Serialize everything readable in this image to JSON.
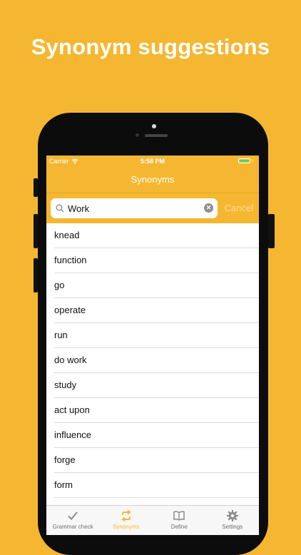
{
  "headline": "Synonym suggestions",
  "status_bar": {
    "carrier": "Carrier",
    "time": "5:58 PM"
  },
  "nav": {
    "title": "Synonyms"
  },
  "search": {
    "value": "Work",
    "cancel_label": "Cancel"
  },
  "results": [
    "knead",
    "function",
    "go",
    "operate",
    "run",
    "do work",
    "study",
    "act upon",
    "influence",
    "forge",
    "form"
  ],
  "tabs": [
    {
      "label": "Grammar check",
      "icon": "checkmark-icon",
      "active": false
    },
    {
      "label": "Synonyms",
      "icon": "repeat-icon",
      "active": true
    },
    {
      "label": "Define",
      "icon": "book-icon",
      "active": false
    },
    {
      "label": "Settings",
      "icon": "gear-icon",
      "active": false
    }
  ],
  "colors": {
    "accent": "#F5B731",
    "battery": "#4CD964"
  }
}
